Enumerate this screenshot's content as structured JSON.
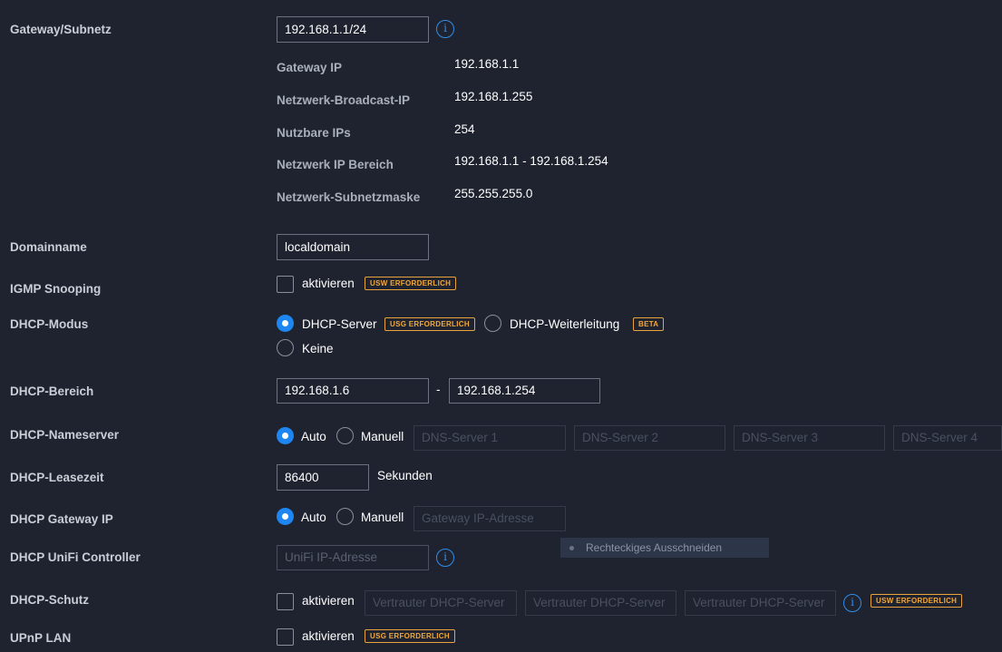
{
  "gateway_subnet": {
    "label": "Gateway/Subnetz",
    "value": "192.168.1.1/24",
    "info_icon": "info-icon",
    "details": [
      {
        "label": "Gateway IP",
        "value": "192.168.1.1"
      },
      {
        "label": "Netzwerk-Broadcast-IP",
        "value": "192.168.1.255"
      },
      {
        "label": "Nutzbare IPs",
        "value": "254"
      },
      {
        "label": "Netzwerk IP Bereich",
        "value": "192.168.1.1 - 192.168.1.254"
      },
      {
        "label": "Netzwerk-Subnetzmaske",
        "value": "255.255.255.0"
      }
    ]
  },
  "domainname": {
    "label": "Domainname",
    "value": "localdomain"
  },
  "igmp": {
    "label": "IGMP Snooping",
    "checkbox_label": "aktivieren",
    "checked": false,
    "badge": "USW ERFORDERLICH"
  },
  "dhcp_mode": {
    "label": "DHCP-Modus",
    "options": [
      {
        "label": "DHCP-Server",
        "selected": true,
        "badge": "USG ERFORDERLICH"
      },
      {
        "label": "DHCP-Weiterleitung",
        "selected": false,
        "badge": "BETA"
      },
      {
        "label": "Keine",
        "selected": false
      }
    ]
  },
  "dhcp_range": {
    "label": "DHCP-Bereich",
    "start": "192.168.1.6",
    "separator": "-",
    "end": "192.168.1.254"
  },
  "dhcp_nameserver": {
    "label": "DHCP-Nameserver",
    "auto_label": "Auto",
    "manual_label": "Manuell",
    "selected": "Auto",
    "placeholders": [
      "DNS-Server 1",
      "DNS-Server 2",
      "DNS-Server 3",
      "DNS-Server 4"
    ]
  },
  "dhcp_lease": {
    "label": "DHCP-Leasezeit",
    "value": "86400",
    "unit": "Sekunden"
  },
  "dhcp_gateway": {
    "label": "DHCP Gateway IP",
    "auto_label": "Auto",
    "manual_label": "Manuell",
    "selected": "Auto",
    "placeholder": "Gateway IP-Adresse"
  },
  "dhcp_unifi": {
    "label": "DHCP UniFi Controller",
    "placeholder": "UniFi IP-Adresse"
  },
  "tooltip": {
    "text": "Rechteckiges Ausschneiden"
  },
  "dhcp_guard": {
    "label": "DHCP-Schutz",
    "checkbox_label": "aktivieren",
    "checked": false,
    "placeholders": [
      "Vertrauter DHCP-Server",
      "Vertrauter DHCP-Server",
      "Vertrauter DHCP-Server"
    ],
    "badge": "USW ERFORDERLICH"
  },
  "upnp": {
    "label": "UPnP LAN",
    "checkbox_label": "aktivieren",
    "checked": false,
    "badge": "USG ERFORDERLICH"
  },
  "colors": {
    "background": "#1f2330",
    "accent": "#1d86f0",
    "badge": "#f2a93b"
  }
}
